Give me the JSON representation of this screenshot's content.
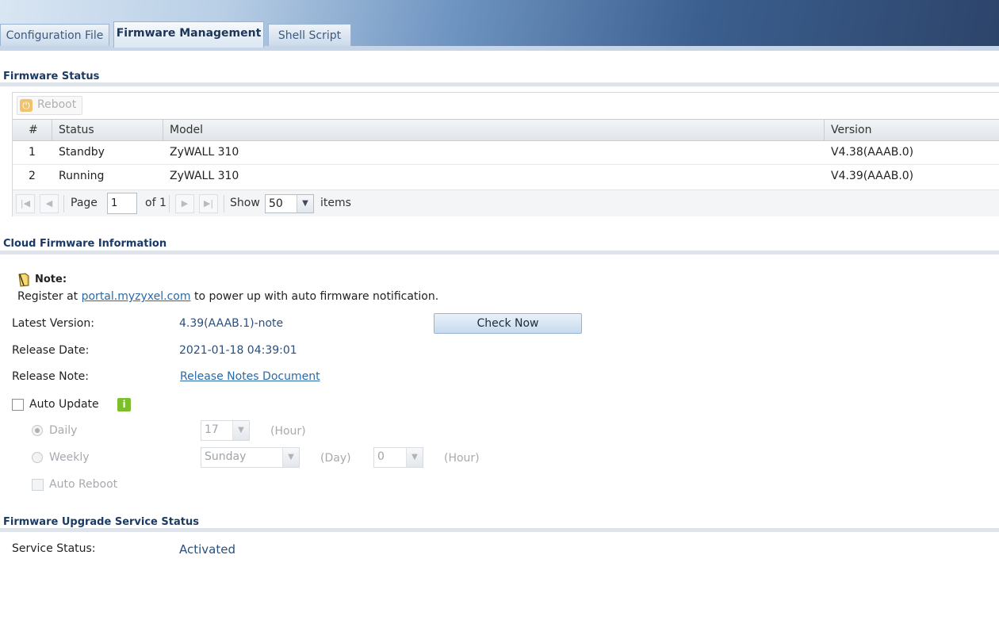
{
  "tabs": [
    {
      "label": "Configuration File"
    },
    {
      "label": "Firmware Management"
    },
    {
      "label": "Shell Script"
    }
  ],
  "firmware_status": {
    "title": "Firmware Status",
    "reboot_label": "Reboot",
    "columns": [
      "#",
      "Status",
      "Model",
      "Version"
    ],
    "rows": [
      {
        "num": "1",
        "status": "Standby",
        "model": "ZyWALL 310",
        "version": "V4.38(AAAB.0)"
      },
      {
        "num": "2",
        "status": "Running",
        "model": "ZyWALL 310",
        "version": "V4.39(AAAB.0)"
      }
    ],
    "pager": {
      "page_label": "Page",
      "page_value": "1",
      "of_label": "of 1",
      "show_label": "Show",
      "show_value": "50",
      "items_label": "items"
    }
  },
  "cloud": {
    "title": "Cloud Firmware Information",
    "note_label": "Note:",
    "note_prefix": "Register at ",
    "note_link": "portal.myzyxel.com",
    "note_suffix": " to power up with auto firmware notification.",
    "latest_version_label": "Latest Version:",
    "latest_version_value": "4.39(AAAB.1)-note",
    "check_now_label": "Check Now",
    "release_date_label": "Release Date:",
    "release_date_value": "2021-01-18 04:39:01",
    "release_note_label": "Release Note:",
    "release_note_link": "Release Notes Document",
    "auto_update_label": "Auto Update",
    "info_icon_text": "i",
    "daily_label": "Daily",
    "daily_hour_value": "17",
    "hour_unit": "(Hour)",
    "weekly_label": "Weekly",
    "weekly_day_value": "Sunday",
    "day_unit": "(Day)",
    "weekly_hour_value": "0",
    "auto_reboot_label": "Auto Reboot"
  },
  "service": {
    "title": "Firmware Upgrade Service Status",
    "status_label": "Service Status:",
    "status_value": "Activated"
  },
  "colors": {
    "accent": "#1b3a63",
    "link": "#2a6aa8",
    "value_blue": "#2a4f7c",
    "info_green": "#7cbf2a"
  }
}
